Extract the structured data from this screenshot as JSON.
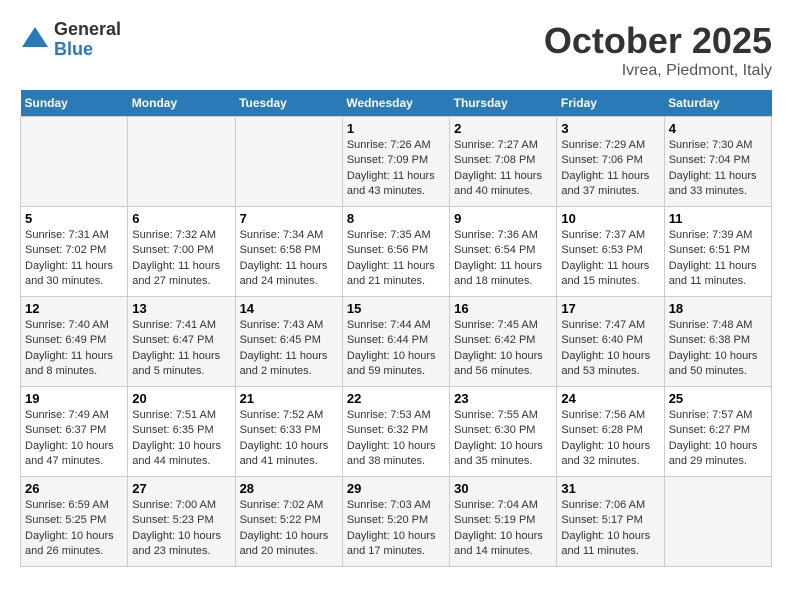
{
  "header": {
    "logo_general": "General",
    "logo_blue": "Blue",
    "month_title": "October 2025",
    "location": "Ivrea, Piedmont, Italy"
  },
  "days_of_week": [
    "Sunday",
    "Monday",
    "Tuesday",
    "Wednesday",
    "Thursday",
    "Friday",
    "Saturday"
  ],
  "weeks": [
    [
      {
        "day": "",
        "info": ""
      },
      {
        "day": "",
        "info": ""
      },
      {
        "day": "",
        "info": ""
      },
      {
        "day": "1",
        "info": "Sunrise: 7:26 AM\nSunset: 7:09 PM\nDaylight: 11 hours and 43 minutes."
      },
      {
        "day": "2",
        "info": "Sunrise: 7:27 AM\nSunset: 7:08 PM\nDaylight: 11 hours and 40 minutes."
      },
      {
        "day": "3",
        "info": "Sunrise: 7:29 AM\nSunset: 7:06 PM\nDaylight: 11 hours and 37 minutes."
      },
      {
        "day": "4",
        "info": "Sunrise: 7:30 AM\nSunset: 7:04 PM\nDaylight: 11 hours and 33 minutes."
      }
    ],
    [
      {
        "day": "5",
        "info": "Sunrise: 7:31 AM\nSunset: 7:02 PM\nDaylight: 11 hours and 30 minutes."
      },
      {
        "day": "6",
        "info": "Sunrise: 7:32 AM\nSunset: 7:00 PM\nDaylight: 11 hours and 27 minutes."
      },
      {
        "day": "7",
        "info": "Sunrise: 7:34 AM\nSunset: 6:58 PM\nDaylight: 11 hours and 24 minutes."
      },
      {
        "day": "8",
        "info": "Sunrise: 7:35 AM\nSunset: 6:56 PM\nDaylight: 11 hours and 21 minutes."
      },
      {
        "day": "9",
        "info": "Sunrise: 7:36 AM\nSunset: 6:54 PM\nDaylight: 11 hours and 18 minutes."
      },
      {
        "day": "10",
        "info": "Sunrise: 7:37 AM\nSunset: 6:53 PM\nDaylight: 11 hours and 15 minutes."
      },
      {
        "day": "11",
        "info": "Sunrise: 7:39 AM\nSunset: 6:51 PM\nDaylight: 11 hours and 11 minutes."
      }
    ],
    [
      {
        "day": "12",
        "info": "Sunrise: 7:40 AM\nSunset: 6:49 PM\nDaylight: 11 hours and 8 minutes."
      },
      {
        "day": "13",
        "info": "Sunrise: 7:41 AM\nSunset: 6:47 PM\nDaylight: 11 hours and 5 minutes."
      },
      {
        "day": "14",
        "info": "Sunrise: 7:43 AM\nSunset: 6:45 PM\nDaylight: 11 hours and 2 minutes."
      },
      {
        "day": "15",
        "info": "Sunrise: 7:44 AM\nSunset: 6:44 PM\nDaylight: 10 hours and 59 minutes."
      },
      {
        "day": "16",
        "info": "Sunrise: 7:45 AM\nSunset: 6:42 PM\nDaylight: 10 hours and 56 minutes."
      },
      {
        "day": "17",
        "info": "Sunrise: 7:47 AM\nSunset: 6:40 PM\nDaylight: 10 hours and 53 minutes."
      },
      {
        "day": "18",
        "info": "Sunrise: 7:48 AM\nSunset: 6:38 PM\nDaylight: 10 hours and 50 minutes."
      }
    ],
    [
      {
        "day": "19",
        "info": "Sunrise: 7:49 AM\nSunset: 6:37 PM\nDaylight: 10 hours and 47 minutes."
      },
      {
        "day": "20",
        "info": "Sunrise: 7:51 AM\nSunset: 6:35 PM\nDaylight: 10 hours and 44 minutes."
      },
      {
        "day": "21",
        "info": "Sunrise: 7:52 AM\nSunset: 6:33 PM\nDaylight: 10 hours and 41 minutes."
      },
      {
        "day": "22",
        "info": "Sunrise: 7:53 AM\nSunset: 6:32 PM\nDaylight: 10 hours and 38 minutes."
      },
      {
        "day": "23",
        "info": "Sunrise: 7:55 AM\nSunset: 6:30 PM\nDaylight: 10 hours and 35 minutes."
      },
      {
        "day": "24",
        "info": "Sunrise: 7:56 AM\nSunset: 6:28 PM\nDaylight: 10 hours and 32 minutes."
      },
      {
        "day": "25",
        "info": "Sunrise: 7:57 AM\nSunset: 6:27 PM\nDaylight: 10 hours and 29 minutes."
      }
    ],
    [
      {
        "day": "26",
        "info": "Sunrise: 6:59 AM\nSunset: 5:25 PM\nDaylight: 10 hours and 26 minutes."
      },
      {
        "day": "27",
        "info": "Sunrise: 7:00 AM\nSunset: 5:23 PM\nDaylight: 10 hours and 23 minutes."
      },
      {
        "day": "28",
        "info": "Sunrise: 7:02 AM\nSunset: 5:22 PM\nDaylight: 10 hours and 20 minutes."
      },
      {
        "day": "29",
        "info": "Sunrise: 7:03 AM\nSunset: 5:20 PM\nDaylight: 10 hours and 17 minutes."
      },
      {
        "day": "30",
        "info": "Sunrise: 7:04 AM\nSunset: 5:19 PM\nDaylight: 10 hours and 14 minutes."
      },
      {
        "day": "31",
        "info": "Sunrise: 7:06 AM\nSunset: 5:17 PM\nDaylight: 10 hours and 11 minutes."
      },
      {
        "day": "",
        "info": ""
      }
    ]
  ]
}
